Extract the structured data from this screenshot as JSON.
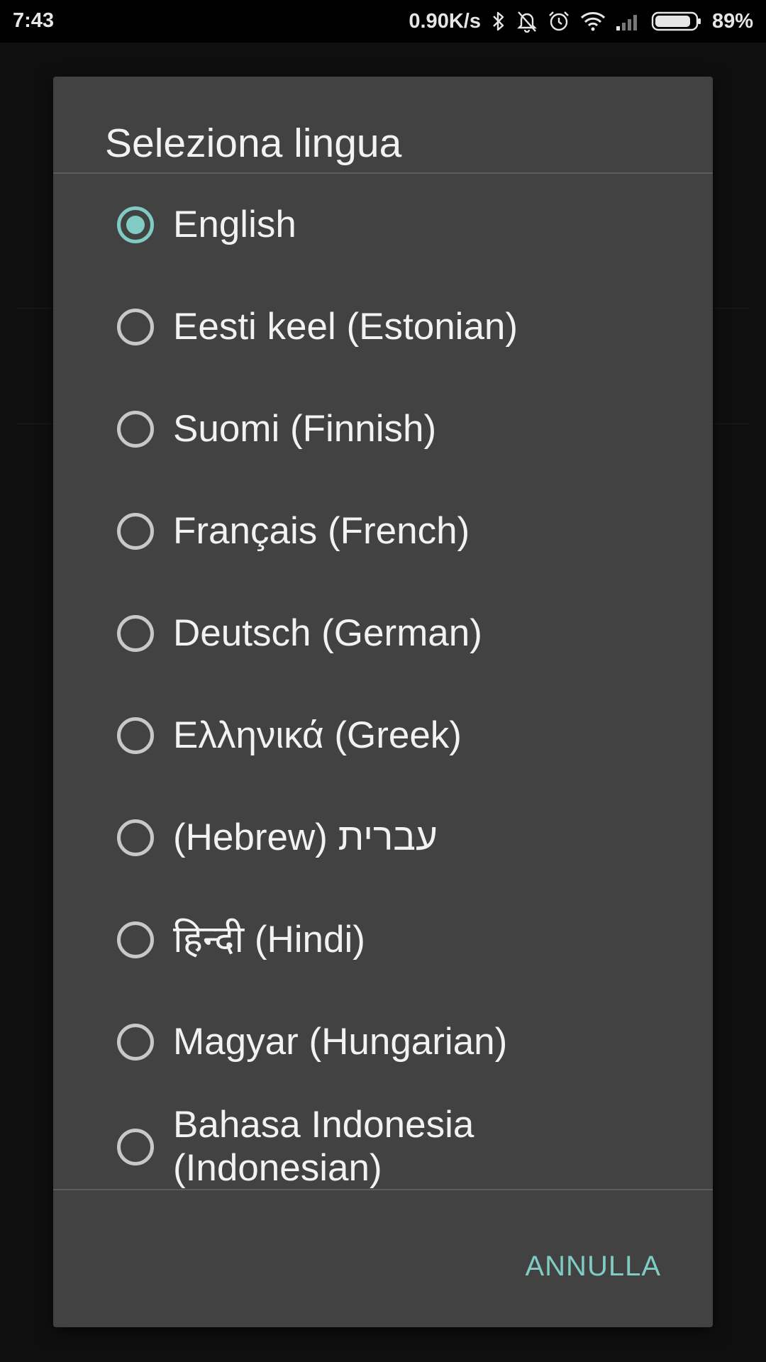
{
  "status_bar": {
    "time": "7:43",
    "speed": "0.90K/s",
    "battery": "89%",
    "battery_level": 0.89,
    "icons": [
      "bluetooth-icon",
      "bell-off-icon",
      "alarm-icon",
      "wifi-icon",
      "signal-icon",
      "battery-icon"
    ]
  },
  "dialog": {
    "title": "Seleziona lingua",
    "options": [
      {
        "label": "English",
        "selected": true
      },
      {
        "label": "Eesti keel (Estonian)",
        "selected": false
      },
      {
        "label": "Suomi (Finnish)",
        "selected": false
      },
      {
        "label": "Français (French)",
        "selected": false
      },
      {
        "label": "Deutsch (German)",
        "selected": false
      },
      {
        "label": "Ελληνικά (Greek)",
        "selected": false
      },
      {
        "label": "(Hebrew) עברית",
        "selected": false
      },
      {
        "label": "हिन्दी (Hindi)",
        "selected": false
      },
      {
        "label": "Magyar (Hungarian)",
        "selected": false
      },
      {
        "label": "Bahasa Indonesia (Indonesian)",
        "selected": false
      }
    ],
    "cancel_label": "ANNULLA"
  },
  "colors": {
    "accent": "#80cbc4",
    "dialog_bg": "#424242",
    "screen_bg": "#0f0f0f"
  }
}
